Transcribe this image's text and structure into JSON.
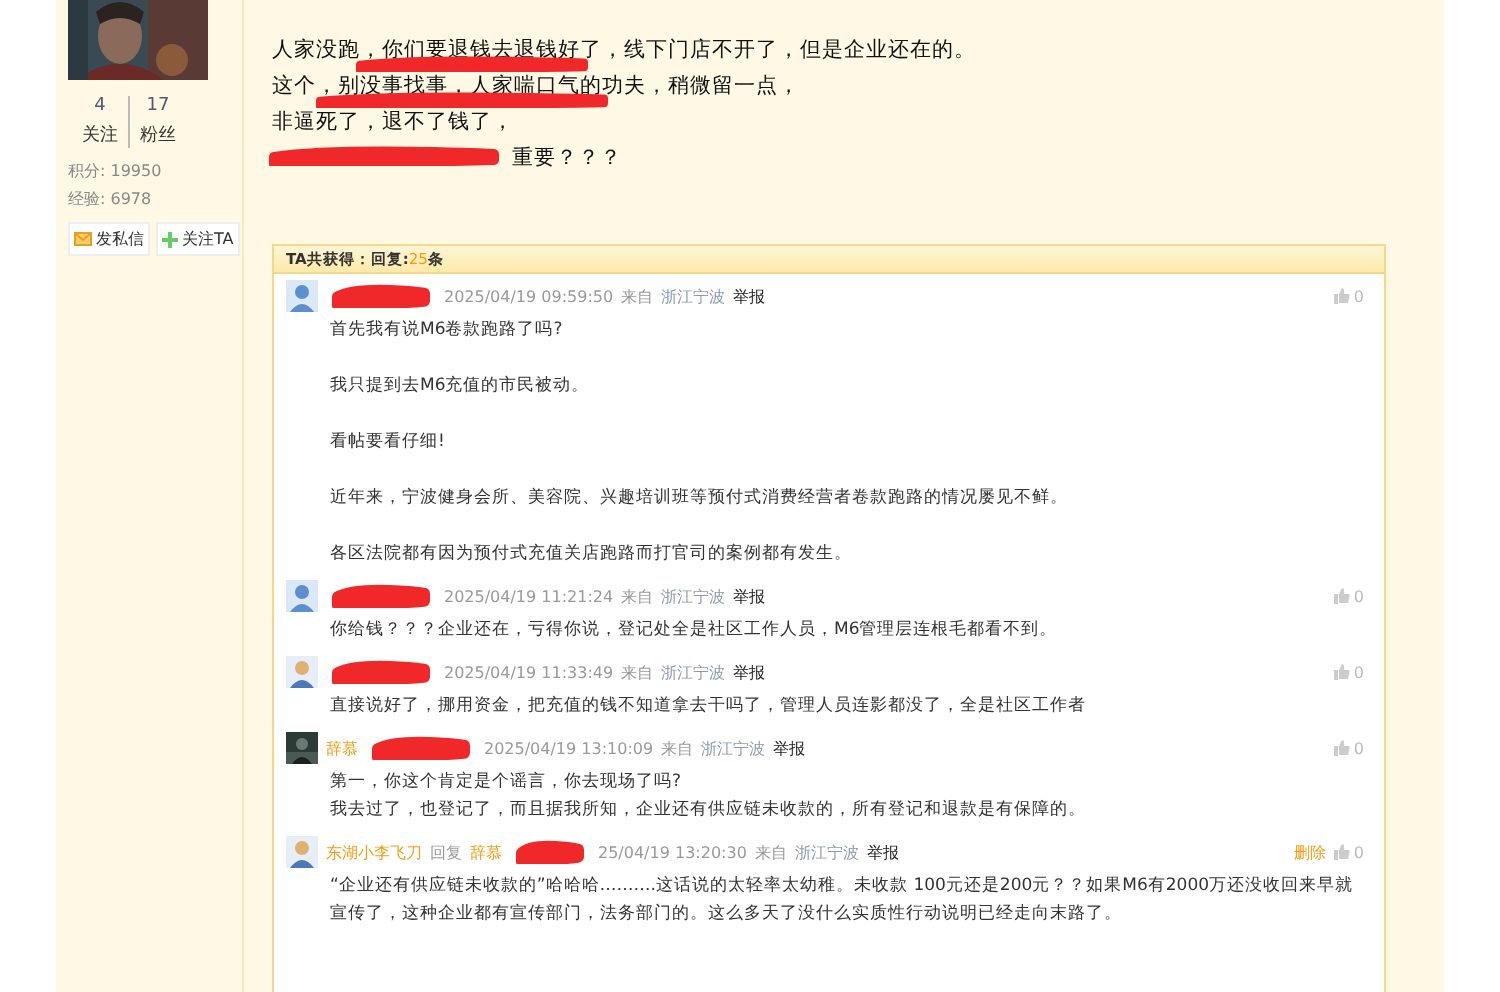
{
  "profile": {
    "following_count": "4",
    "following_label": "关注",
    "followers_count": "17",
    "followers_label": "粉丝",
    "points": "积分: 19950",
    "experience": "经验: 6978",
    "buttons": [
      {
        "kind": "message",
        "label": "发私信"
      },
      {
        "kind": "follow",
        "label": "关注TA"
      }
    ]
  },
  "post": {
    "lines": [
      {
        "text": "人家没跑，你们要退钱去退钱好了，线下门店不开了，但是企业还在的。",
        "redacted": true
      },
      {
        "text": "这个，别没事找事，人家喘口气的功夫，稍微留一点，",
        "redacted": true
      },
      {
        "text": "非逼死了，退不了钱了，",
        "redacted": false
      },
      {
        "text": "重要？？？",
        "redacted": true
      }
    ]
  },
  "replies": {
    "header_label": "TA共获得：",
    "header_prefix": "回复:",
    "header_count": "25",
    "header_suffix": "条",
    "items": [
      {
        "avatar": {
          "kind": "default"
        },
        "redacted": true,
        "time": "2025/04/19 09:59:50",
        "from": "来自",
        "location": "浙江宁波",
        "report": "举报",
        "likes": "0",
        "paragraphs": [
          "首先我有说M6卷款跑路了吗?",
          "我只提到去M6充值的市民被动。",
          "看帖要看仔细!",
          "近年来，宁波健身会所、美容院、兴趣培训班等预付式消费经营者卷款跑路的情况屡见不鲜。",
          "各区法院都有因为预付式充值关店跑路而打官司的案例都有发生。"
        ]
      },
      {
        "avatar": {
          "kind": "default"
        },
        "redacted": true,
        "time": "2025/04/19 11:21:24",
        "from": "来自",
        "location": "浙江宁波",
        "report": "举报",
        "likes": "0",
        "paragraphs": [
          "你给钱？？？企业还在，亏得你说，登记处全是社区工作人员，M6管理层连根毛都看不到。"
        ]
      },
      {
        "avatar": {
          "kind": "person"
        },
        "redacted": true,
        "time": "2025/04/19 11:33:49",
        "from": "来自",
        "location": "浙江宁波",
        "report": "举报",
        "likes": "0",
        "paragraphs": [
          "直接说好了，挪用资金，把充值的钱不知道拿去干吗了，管理人员连影都没了，全是社区工作者"
        ]
      },
      {
        "author": "辞慕",
        "redacted": true,
        "time": "2025/04/19 13:10:09",
        "from": "来自",
        "location": "浙江宁波",
        "report": "举报",
        "likes": "0",
        "lines": [
          "第一，你这个肯定是个谣言，你去现场了吗?",
          "我去过了，也登记了，而且据我所知，企业还有供应链未收款的，所有登记和退款是有保障的。"
        ]
      },
      {
        "avatar": {
          "kind": "person"
        },
        "author": "东湖小李飞刀",
        "reply_label": "回复",
        "reply_to": "辞慕",
        "redacted": true,
        "time": "25/04/19 13:20:30",
        "from": "来自",
        "location": "浙江宁波",
        "report": "举报",
        "delete": "删除",
        "likes": "0",
        "lines": [
          "“企业还有供应链未收款的”哈哈哈……….这话说的太轻率太幼稚。未收款 100元还是200元？？如果M6有2000万还没收回来早就宣传了，这种企业都有宣传部门，法务部门的。这么多天了没什么实质性行动说明已经走向末路了。"
        ]
      }
    ]
  }
}
